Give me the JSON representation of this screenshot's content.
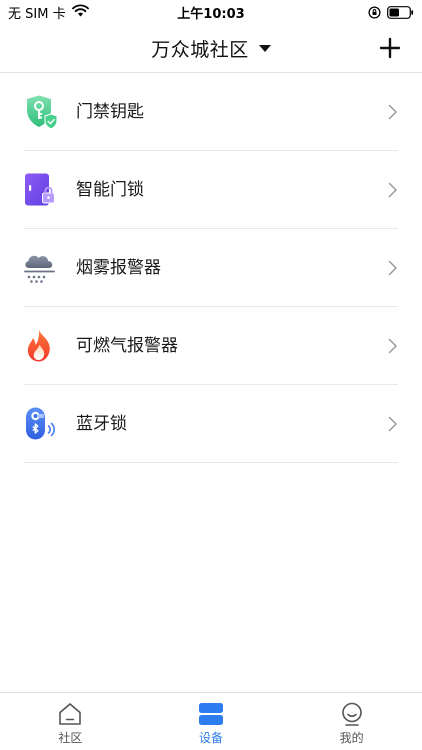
{
  "status_bar": {
    "carrier": "无 SIM 卡",
    "time": "上午10:03",
    "wifi_icon": "wifi-icon",
    "orientation_lock_icon": "orientation-lock-icon",
    "battery_icon": "battery-icon"
  },
  "header": {
    "title": "万众城社区",
    "dropdown_icon": "caret-down-icon",
    "add_icon": "plus-icon"
  },
  "devices": [
    {
      "label": "门禁钥匙",
      "icon": "shield-key-icon"
    },
    {
      "label": "智能门锁",
      "icon": "smart-door-lock-icon"
    },
    {
      "label": "烟雾报警器",
      "icon": "smoke-alarm-icon"
    },
    {
      "label": "可燃气报警器",
      "icon": "flame-icon"
    },
    {
      "label": "蓝牙锁",
      "icon": "bluetooth-lock-icon"
    }
  ],
  "tab_bar": {
    "tabs": [
      {
        "label": "社区",
        "icon": "home-icon",
        "active": false
      },
      {
        "label": "设备",
        "icon": "devices-icon",
        "active": true
      },
      {
        "label": "我的",
        "icon": "profile-icon",
        "active": false
      }
    ]
  },
  "colors": {
    "accent": "#2d7cf0",
    "divider": "#e9e9e9"
  }
}
